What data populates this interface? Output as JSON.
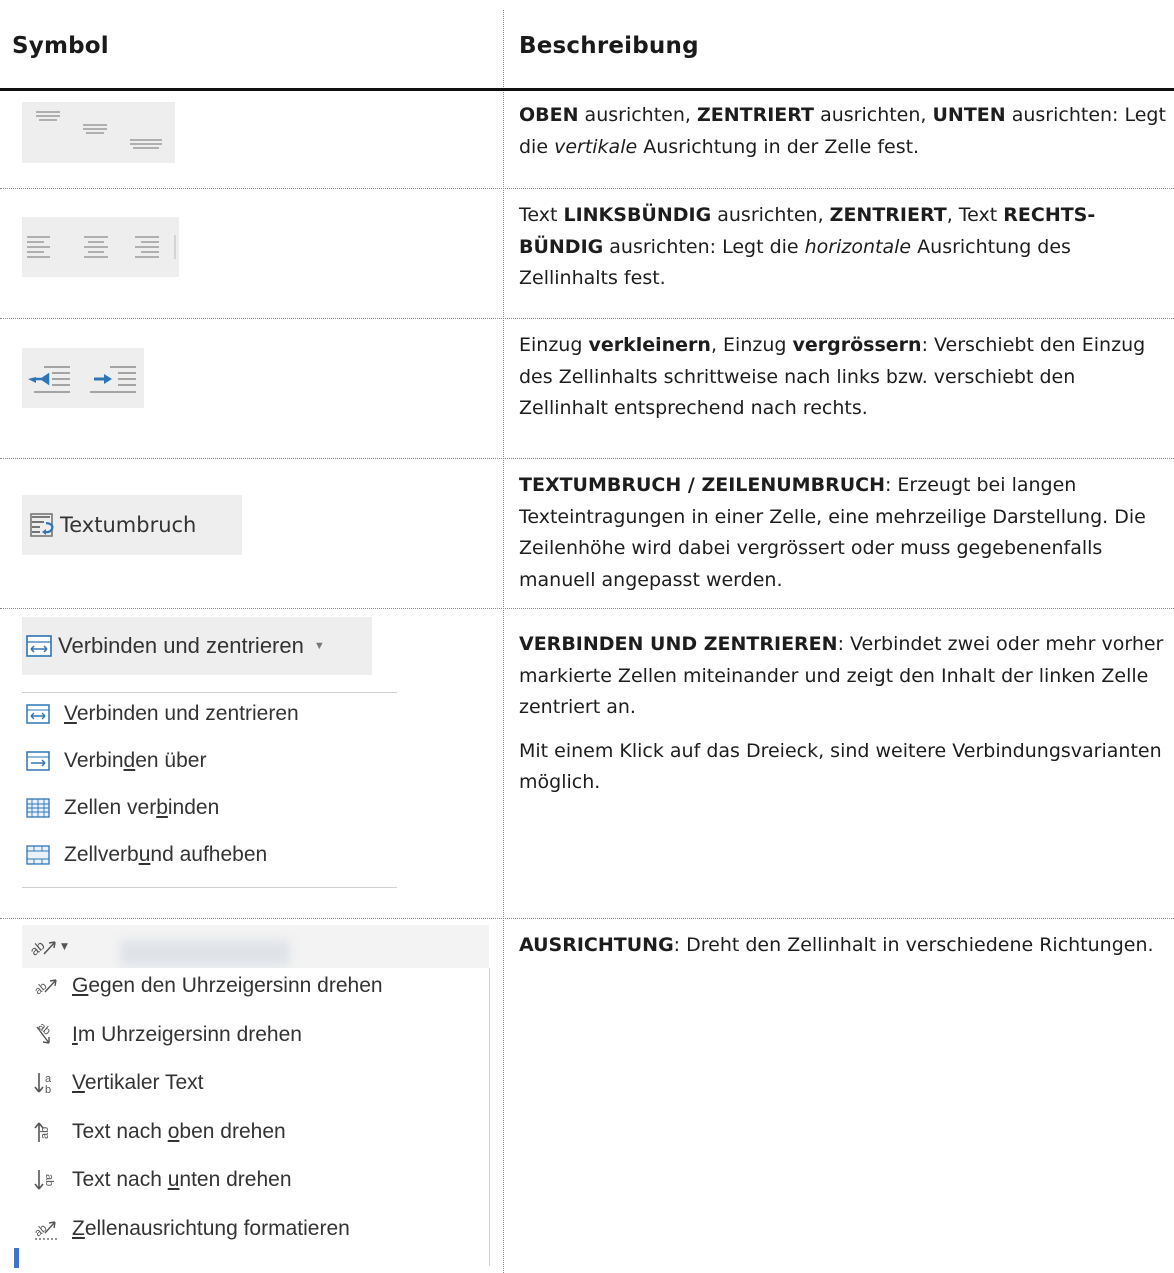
{
  "header": {
    "col1": "Symbol",
    "col2": "Beschreibung"
  },
  "rows": [
    {
      "icon": "vertical-align-icons",
      "parts": [
        {
          "t": "OBEN",
          "b": true
        },
        {
          "t": " ausrichten, "
        },
        {
          "t": "ZENTRIERT",
          "b": true
        },
        {
          "t": " ausrichten, "
        },
        {
          "t": "UNTEN",
          "b": true
        },
        {
          "t": " ausrich­ten: Legt die "
        },
        {
          "t": "vertikale",
          "i": true
        },
        {
          "t": " Ausrichtung in der Zelle fest."
        }
      ]
    },
    {
      "icon": "horizontal-align-icons",
      "parts": [
        {
          "t": "Text "
        },
        {
          "t": "LINKSBÜNDIG",
          "b": true
        },
        {
          "t": " ausrichten, "
        },
        {
          "t": "ZENTRIERT",
          "b": true
        },
        {
          "t": ", Text "
        },
        {
          "t": "RECHTS­BÜNDIG",
          "b": true
        },
        {
          "t": " ausrichten: Legt die "
        },
        {
          "t": "horizontale",
          "i": true
        },
        {
          "t": " Ausrichtung des Zellinhalts fest."
        }
      ]
    },
    {
      "icon": "indent-icons",
      "parts": [
        {
          "t": "Einzug "
        },
        {
          "t": "verkleinern",
          "b": true
        },
        {
          "t": ", Einzug "
        },
        {
          "t": "vergrössern",
          "b": true
        },
        {
          "t": ": Verschiebt den Einzug des Zellinhalts schrittweise nach links bzw. ver­schiebt den Zellinhalt entsprechend nach rechts."
        }
      ]
    },
    {
      "icon": "wrap-text-icon",
      "button_label": "Textumbruch",
      "parts": [
        {
          "t": "TEXTUMBRUCH / ZEILENUMBRUCH",
          "b": true
        },
        {
          "t": ": Erzeugt bei langen Texteintragungen in einer Zelle, eine mehrzeilige Darstel­lung. Die Zeilenhöhe wird dabei vergrössert oder muss gegebenenfalls manuell angepasst werden."
        }
      ]
    },
    {
      "icon": "merge-center-icon",
      "button_label": "Verbinden und zentrieren",
      "menu": [
        {
          "pre": "",
          "u": "V",
          "post": "erbinden und zentrieren",
          "icon": "merge-center-icon"
        },
        {
          "pre": "Verbin",
          "u": "d",
          "post": "en über",
          "icon": "merge-across-icon"
        },
        {
          "pre": "Zellen ver",
          "u": "b",
          "post": "inden",
          "icon": "merge-cells-icon"
        },
        {
          "pre": "Zellverb",
          "u": "u",
          "post": "nd aufheben",
          "icon": "unmerge-cells-icon"
        }
      ],
      "parts": [
        {
          "t": "VERBINDEN UND ZENTRIEREN",
          "b": true
        },
        {
          "t": ": Verbindet zwei oder mehr vorher markierte Zellen miteinander und zeigt den Inhalt der linken Zelle zentriert an."
        }
      ],
      "parts2": [
        {
          "t": "Mit einem Klick auf das Dreieck, sind weitere Verbin­dungsvarianten möglich."
        }
      ]
    },
    {
      "icon": "orientation-icon",
      "menu": [
        {
          "pre": "",
          "u": "G",
          "post": "egen den Uhrzeigersinn drehen",
          "icon": "rotate-ccw-icon"
        },
        {
          "pre": "",
          "u": "I",
          "post": "m Uhrzeigersinn drehen",
          "icon": "rotate-cw-icon"
        },
        {
          "pre": "",
          "u": "V",
          "post": "ertikaler Text",
          "icon": "vertical-text-icon"
        },
        {
          "pre": "Text nach ",
          "u": "o",
          "post": "ben drehen",
          "icon": "rotate-up-icon"
        },
        {
          "pre": "Text nach ",
          "u": "u",
          "post": "nten drehen",
          "icon": "rotate-down-icon"
        },
        {
          "pre": "",
          "u": "Z",
          "post": "ellenausrichtung formatieren",
          "icon": "format-alignment-icon"
        }
      ],
      "parts": [
        {
          "t": "AUSRICHTUNG",
          "b": true
        },
        {
          "t": ": Dreht den Zellinhalt in verschiedene Rich­tungen."
        }
      ]
    }
  ],
  "colors": {
    "accent_blue": "#2e75b6",
    "button_bg": "#eeeeee",
    "icon_gray": "#8a8a8a"
  }
}
